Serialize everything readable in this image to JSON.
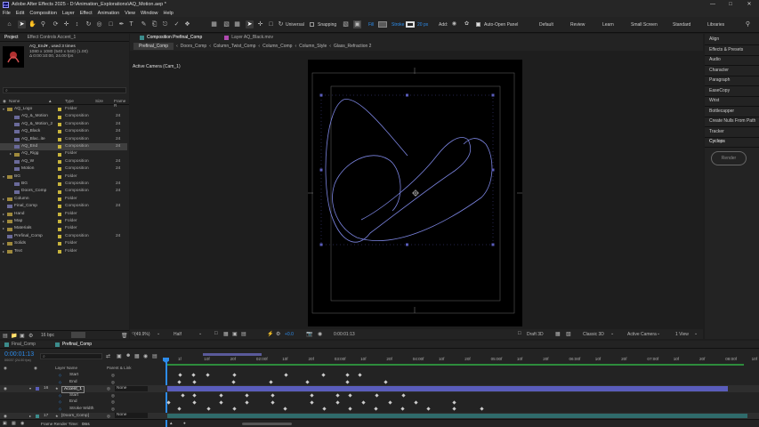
{
  "app": {
    "title": "Adobe After Effects 2025 - D:\\Animation_Explorations\\AQ_Motion.aep *",
    "menu": [
      "File",
      "Edit",
      "Composition",
      "Layer",
      "Effect",
      "Animation",
      "View",
      "Window",
      "Help"
    ]
  },
  "toolbar": {
    "universal_label": "Universal",
    "snapping_label": "Snapping",
    "fill_label": "Fill",
    "stroke_label": "Stroke",
    "stroke_px": "20 px",
    "add_label": "Add:",
    "auto_open_label": "Auto-Open Panel",
    "workspaces": [
      "Default",
      "Review",
      "Learn",
      "Small Screen",
      "Standard",
      "Libraries"
    ]
  },
  "project": {
    "tabs": [
      "Project",
      "Effect Controls Accent_1"
    ],
    "selected_name": "AQ_End▾ , used 3 times",
    "selected_size": "1080 x 1080  (540 x 540) (1.00)",
    "selected_duration": "Δ 0:00:10:00, 24.00 fps",
    "search_placeholder": "⌕",
    "columns": [
      "Name",
      "Type",
      "Size",
      "Frame R"
    ],
    "bpc": "16 bpc",
    "items": [
      {
        "name": "AQ_Logo",
        "type": "Folder",
        "fr": "",
        "indent": 0,
        "folder": true,
        "open": true,
        "color": "#c8b43c"
      },
      {
        "name": "AQ_&_Motion",
        "type": "Composition",
        "fr": "24",
        "indent": 1,
        "folder": false,
        "color": "#c8b43c"
      },
      {
        "name": "AQ_&_Motion_2",
        "type": "Composition",
        "fr": "24",
        "indent": 1,
        "folder": false,
        "color": "#c8b43c"
      },
      {
        "name": "AQ_Black",
        "type": "Composition",
        "fr": "24",
        "indent": 1,
        "folder": false,
        "color": "#c8b43c"
      },
      {
        "name": "AQ_Blac..ite",
        "type": "Composition",
        "fr": "24",
        "indent": 1,
        "folder": false,
        "color": "#c8b43c"
      },
      {
        "name": "AQ_End",
        "type": "Composition",
        "fr": "24",
        "indent": 1,
        "folder": false,
        "color": "#c8b43c",
        "selected": true
      },
      {
        "name": "AQ_Rigg",
        "type": "Folder",
        "fr": "",
        "indent": 1,
        "folder": true,
        "open": false,
        "color": "#c8b43c"
      },
      {
        "name": "AQ_W",
        "type": "Composition",
        "fr": "24",
        "indent": 1,
        "folder": false,
        "color": "#c8b43c"
      },
      {
        "name": "Motion",
        "type": "Composition",
        "fr": "24",
        "indent": 1,
        "folder": false,
        "color": "#c8b43c"
      },
      {
        "name": "BG",
        "type": "Folder",
        "fr": "",
        "indent": 0,
        "folder": true,
        "open": true,
        "color": "#c8b43c"
      },
      {
        "name": "BG",
        "type": "Composition",
        "fr": "24",
        "indent": 1,
        "folder": false,
        "color": "#c8b43c"
      },
      {
        "name": "Doors_Comp",
        "type": "Composition",
        "fr": "24",
        "indent": 1,
        "folder": false,
        "color": "#c8b43c"
      },
      {
        "name": "Column",
        "type": "Folder",
        "fr": "",
        "indent": 0,
        "folder": true,
        "open": false,
        "color": "#c8b43c"
      },
      {
        "name": "Final_Comp",
        "type": "Composition",
        "fr": "24",
        "indent": 0,
        "folder": false,
        "color": "#c8b43c"
      },
      {
        "name": "Hand",
        "type": "Folder",
        "fr": "",
        "indent": 0,
        "folder": true,
        "open": false,
        "color": "#c8b43c"
      },
      {
        "name": "Map",
        "type": "Folder",
        "fr": "",
        "indent": 0,
        "folder": true,
        "open": false,
        "color": "#c8b43c"
      },
      {
        "name": "Materials",
        "type": "Folder",
        "fr": "",
        "indent": 0,
        "folder": true,
        "open": false,
        "color": "#c8b43c"
      },
      {
        "name": "Prefinal_Comp",
        "type": "Composition",
        "fr": "24",
        "indent": 0,
        "folder": false,
        "color": "#c8b43c"
      },
      {
        "name": "Solids",
        "type": "Folder",
        "fr": "",
        "indent": 0,
        "folder": true,
        "open": false,
        "color": "#c8b43c"
      },
      {
        "name": "Text",
        "type": "Folder",
        "fr": "",
        "indent": 0,
        "folder": true,
        "open": false,
        "color": "#c8b43c"
      }
    ]
  },
  "viewer": {
    "tabs": [
      "Composition Prefinal_Comp",
      "Layer AQ_Black.mov"
    ],
    "breadcrumbs": [
      "Prefinal_Comp",
      "Doors_Comp",
      "Column_Twist_Comp",
      "Column_Comp",
      "Column_Style",
      "Glass_Refraction 2"
    ],
    "camera_label": "Active Camera (Cam_1)",
    "zoom": "(49.9%)",
    "resolution": "Half",
    "exposure": "+0.0",
    "timecode": "0:00:01:13",
    "renderer": "Draft 3D",
    "classic3d": "Classic 3D",
    "camera_select": "Active Camera",
    "views": "1 View"
  },
  "right_panel": {
    "items": [
      "Align",
      "Effects & Presets",
      "Audio",
      "Character",
      "Paragraph",
      "EaseCopy",
      "Wrist",
      "Bottlecapper",
      "Create Nulls From Path",
      "Tracker",
      "Cyclops"
    ],
    "render_label": "Render"
  },
  "timeline": {
    "tabs": [
      "Final_Comp",
      "Prefinal_Comp"
    ],
    "timecode": "0:00:01:13",
    "timecode_sub": "00037 (24.00 fps)",
    "search_placeholder": "⌕",
    "col_layer_name": "Layer Name",
    "col_parent": "Parent & Link",
    "ruler": [
      "1f",
      "10f",
      "20f",
      "02:00f",
      "10f",
      "20f",
      "03:00f",
      "10f",
      "20f",
      "04:00f",
      "10f",
      "20f",
      "05:00f",
      "10f",
      "20f",
      "06:00f",
      "10f",
      "20f",
      "07:00f",
      "10f",
      "20f",
      "08:00f",
      "10f",
      "20f"
    ],
    "layers": [
      {
        "num": "",
        "name": "Start",
        "kind": "prop",
        "parent": ""
      },
      {
        "num": "",
        "name": "End",
        "kind": "prop",
        "parent": ""
      },
      {
        "num": "16",
        "name": "Accent_1",
        "kind": "layer",
        "parent": "None"
      },
      {
        "num": "",
        "name": "Start",
        "kind": "prop",
        "parent": ""
      },
      {
        "num": "",
        "name": "End",
        "kind": "prop",
        "parent": ""
      },
      {
        "num": "",
        "name": "Stroke Width",
        "kind": "prop",
        "parent": ""
      },
      {
        "num": "17",
        "name": "[Doors_Comp]",
        "kind": "layer",
        "parent": "None"
      }
    ],
    "footer_label": "Frame Render Time:",
    "footer_value": "0ms"
  },
  "colors": {
    "accent_blue": "#2d8ceb",
    "layer_bar": "#5a5dbb",
    "label_yellow": "#c8b43c",
    "label_teal": "#3c8c8c"
  }
}
